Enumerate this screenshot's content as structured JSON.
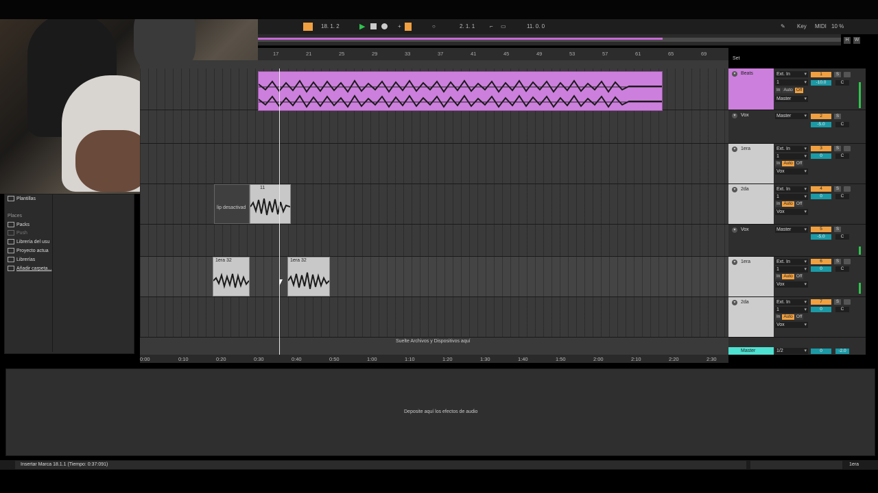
{
  "transport": {
    "position": "18.  1.  2",
    "loop_length": "2.  1.  1",
    "loop_end": "11.  0.  0",
    "key_label": "Key",
    "midi_label": "MIDI",
    "cpu": "10 %",
    "h_label": "H",
    "w_label": "W"
  },
  "ruler": {
    "bars": [
      "17",
      "21",
      "25",
      "29",
      "33",
      "37",
      "41",
      "45",
      "49",
      "53",
      "57",
      "61",
      "65",
      "69"
    ]
  },
  "timeline": {
    "times": [
      "0:00",
      "0:10",
      "0:20",
      "0:30",
      "0:40",
      "0:50",
      "1:00",
      "1:10",
      "1:20",
      "1:30",
      "1:40",
      "1:50",
      "2:00",
      "2:10",
      "2:20",
      "2:30"
    ]
  },
  "clips": {
    "clip_11": "11",
    "clip_deactivated": "lip desactivad",
    "clip_1era_a": "1era 32",
    "clip_1era_b": "1era 32"
  },
  "drop_hint": "Suelte Archivos y Dispositivos aquí",
  "set_label": "Set",
  "tracks": [
    {
      "name": "Beats",
      "input": "Ext. In",
      "channel": "1",
      "monitor": [
        "In",
        "Auto",
        "Off"
      ],
      "output": "Master",
      "number": "1",
      "volume": "-10.0",
      "pan": "C"
    },
    {
      "name": "Vox",
      "output": "Master",
      "number": "2",
      "volume": "-5.0",
      "pan": "C"
    },
    {
      "name": "1era",
      "input": "Ext. In",
      "channel": "1",
      "monitor": [
        "In",
        "Auto",
        "Off"
      ],
      "output": "Vox",
      "number": "3",
      "volume": "0",
      "pan": "C"
    },
    {
      "name": "2da",
      "input": "Ext. In",
      "channel": "1",
      "monitor": [
        "In",
        "Auto",
        "Off"
      ],
      "output": "Vox",
      "number": "4",
      "volume": "0",
      "pan": "C"
    },
    {
      "name": "Vox",
      "output": "Master",
      "number": "5",
      "volume": "-5.0",
      "pan": "C"
    },
    {
      "name": "1era",
      "input": "Ext. In",
      "channel": "1",
      "monitor": [
        "In",
        "Auto",
        "Off"
      ],
      "output": "Vox",
      "number": "6",
      "volume": "0",
      "pan": "C"
    },
    {
      "name": "2da",
      "input": "Ext. In",
      "channel": "1",
      "monitor": [
        "In",
        "Auto",
        "Off"
      ],
      "output": "Vox",
      "number": "7",
      "volume": "0",
      "pan": "C"
    }
  ],
  "master": {
    "name": "Master",
    "cue": "1/2",
    "volume": "0",
    "pan": "-2.0"
  },
  "browser": {
    "items_top": [
      "Plantillas"
    ],
    "places_label": "Places",
    "places": [
      "Packs",
      "Push",
      "Librería del usu",
      "Proyecto actua",
      "Librerías",
      "Añadir carpeta..."
    ]
  },
  "devices_hint": "Deposite aquí los efectos de audio",
  "status": {
    "message": "Insertar Marca 18.1.1 (Tiempo: 0:37:091)",
    "track": "1era"
  },
  "colors": {
    "accent": "#f0a040",
    "beats_clip": "#cc7fdc",
    "master": "#4ee0d0",
    "meter": "#2ec44e"
  }
}
